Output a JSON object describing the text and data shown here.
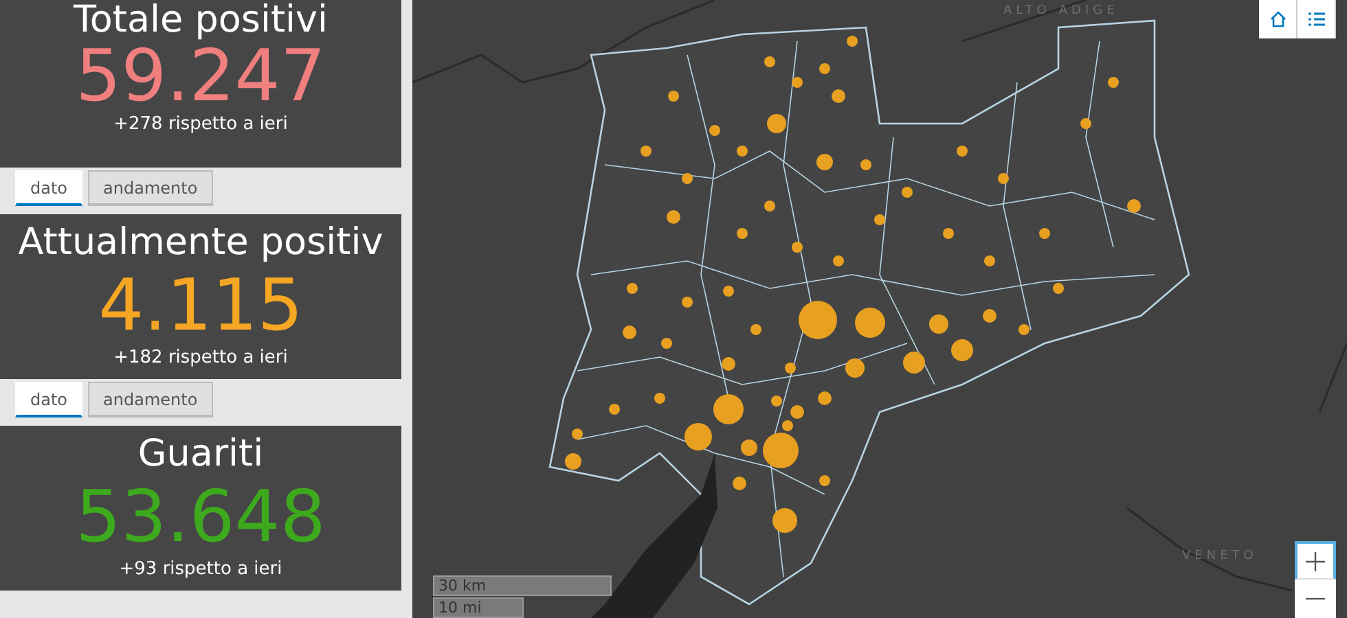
{
  "cards": [
    {
      "title": "Totale positivi",
      "value": "59.247",
      "color": "#f07f7f",
      "delta": "+278 rispetto a ieri",
      "tabs": [
        {
          "label": "dato",
          "selected": true
        },
        {
          "label": "andamento",
          "selected": false
        }
      ]
    },
    {
      "title": "Attualmente positiv",
      "value": "4.115",
      "color": "#f5a623",
      "delta": "+182 rispetto a ieri",
      "tabs": [
        {
          "label": "dato",
          "selected": true
        },
        {
          "label": "andamento",
          "selected": false
        }
      ]
    },
    {
      "title": "Guariti",
      "value": "53.648",
      "color": "#3daa1e",
      "delta": "+93 rispetto a ieri"
    }
  ],
  "map": {
    "region_labels": [
      "ALTO ADIGE",
      "VENETO"
    ],
    "scale": [
      "30 km",
      "10 mi"
    ]
  }
}
